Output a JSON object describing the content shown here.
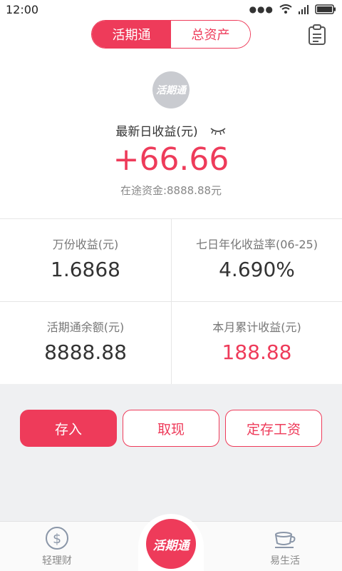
{
  "status_bar": {
    "time": "12:00"
  },
  "header": {
    "tabs": [
      {
        "label": "活期通",
        "active": true
      },
      {
        "label": "总资产",
        "active": false
      }
    ],
    "icon": "clipboard-icon"
  },
  "summary": {
    "logo_text": "活期通",
    "yield_label": "最新日收益(元)",
    "yield_value": "+66.66",
    "in_transit": "在途资金:8888.88元"
  },
  "stats": [
    {
      "label": "万份收益(元)",
      "value": "1.6868"
    },
    {
      "label": "七日年化收益率(06-25)",
      "value": "4.690%"
    },
    {
      "label": "活期通余额(元)",
      "value": "8888.88"
    },
    {
      "label": "本月累计收益(元)",
      "value": "188.88"
    }
  ],
  "actions": {
    "deposit": "存入",
    "withdraw": "取现",
    "fixed_salary": "定存工资"
  },
  "tabbar": {
    "left_label": "轻理财",
    "center_label": "活期通",
    "right_label": "易生活"
  },
  "colors": {
    "accent": "#ee3b5a",
    "background": "#eff0f2"
  }
}
